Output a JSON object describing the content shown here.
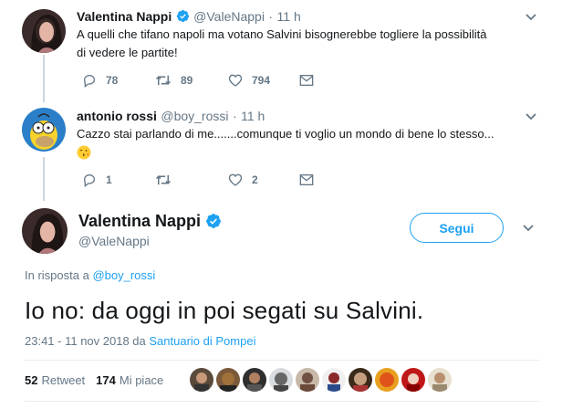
{
  "tweet1": {
    "name": "Valentina Nappi",
    "handle": "@ValeNappi",
    "separator": "·",
    "time": "11 h",
    "text_line1": "A quelli che tifano napoli ma votano Salvini bisognerebbe togliere la possibilità",
    "text_line2": "di vedere le partite!",
    "replies": "78",
    "retweets": "89",
    "likes": "794"
  },
  "tweet2": {
    "name": "antonio rossi",
    "handle": "@boy_rossi",
    "separator": "·",
    "time": "11 h",
    "text": "Cazzo stai parlando di me.......comunque ti voglio un mondo di bene lo stesso...",
    "replies": "1",
    "retweets": "",
    "likes": "2"
  },
  "main": {
    "name": "Valentina Nappi",
    "handle": "@ValeNappi",
    "follow_label": "Segui",
    "reply_prefix": "In risposta a",
    "reply_to": "@boy_rossi",
    "text": "Io no: da oggi in poi segati su Salvini.",
    "timestamp": "23:41 - 11 nov 2018 da",
    "location": "Santuario di Pompei",
    "retweets_count": "52",
    "retweets_label": "Retweet",
    "likes_count": "174",
    "likes_label": "Mi piace"
  },
  "icons": {
    "verified": "verified-badge-icon",
    "reply": "reply-icon",
    "retweet": "retweet-icon",
    "like": "heart-icon",
    "message": "envelope-icon",
    "caret": "chevron-down-icon"
  },
  "colors": {
    "accent": "#1da1f2",
    "muted": "#657786",
    "thread_line": "#ccd6dd"
  }
}
